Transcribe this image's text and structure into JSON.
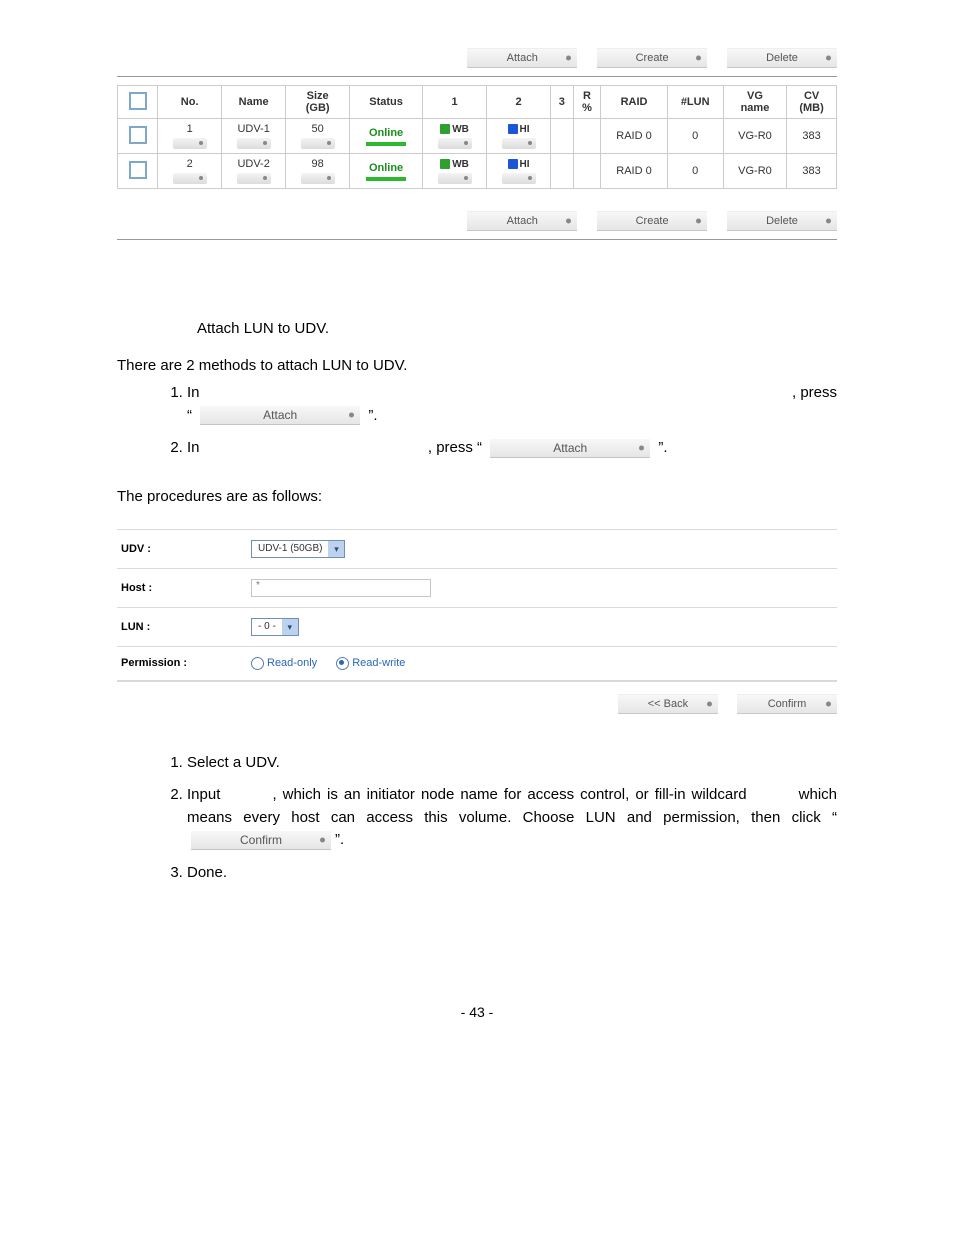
{
  "buttons": {
    "attach": "Attach",
    "create": "Create",
    "delete": "Delete",
    "back": "<< Back",
    "confirm": "Confirm"
  },
  "table": {
    "headers": {
      "no": "No.",
      "name": "Name",
      "size": "Size",
      "size_unit": "(GB)",
      "status": "Status",
      "c1": "1",
      "c2": "2",
      "c3": "3",
      "r": "R",
      "r_pct": "%",
      "raid": "RAID",
      "lun": "#LUN",
      "vg": "VG",
      "vg_sub": "name",
      "cv": "CV",
      "cv_unit": "(MB)"
    },
    "rows": [
      {
        "no": "1",
        "name": "UDV-1",
        "size": "50",
        "status": "Online",
        "c1": "WB",
        "c2": "HI",
        "raid": "RAID 0",
        "lun": "0",
        "vg": "VG-R0",
        "cv": "383"
      },
      {
        "no": "2",
        "name": "UDV-2",
        "size": "98",
        "status": "Online",
        "c1": "WB",
        "c2": "HI",
        "raid": "RAID 0",
        "lun": "0",
        "vg": "VG-R0",
        "cv": "383"
      }
    ]
  },
  "section": {
    "attach_title": "Attach LUN to UDV.",
    "intro": "There are 2 methods to attach LUN to UDV.",
    "step1a": "In",
    "step1_press": ",    press",
    "step1_quote_open": "“",
    "step1_quote_close": "”.",
    "step2a": "In",
    "step2_press": ", press “",
    "step2_close": "”.",
    "procedures": "The procedures are as follows:"
  },
  "form": {
    "udv_label": "UDV :",
    "udv_value": "UDV-1 (50GB)",
    "host_label": "Host :",
    "host_value": "*",
    "lun_label": "LUN :",
    "lun_value": "- 0 -",
    "perm_label": "Permission :",
    "perm_ro": "Read-only",
    "perm_rw": "Read-write"
  },
  "instructions": {
    "i1": "Select a UDV.",
    "i2_a": "Input",
    "i2_b": ", which is an initiator node name for access control, or fill-in wildcard",
    "i2_c": "which means every host can access this volume. Choose LUN and permission, then click “",
    "i2_d": "”.",
    "i3": "Done."
  },
  "page_number": "- 43 -"
}
